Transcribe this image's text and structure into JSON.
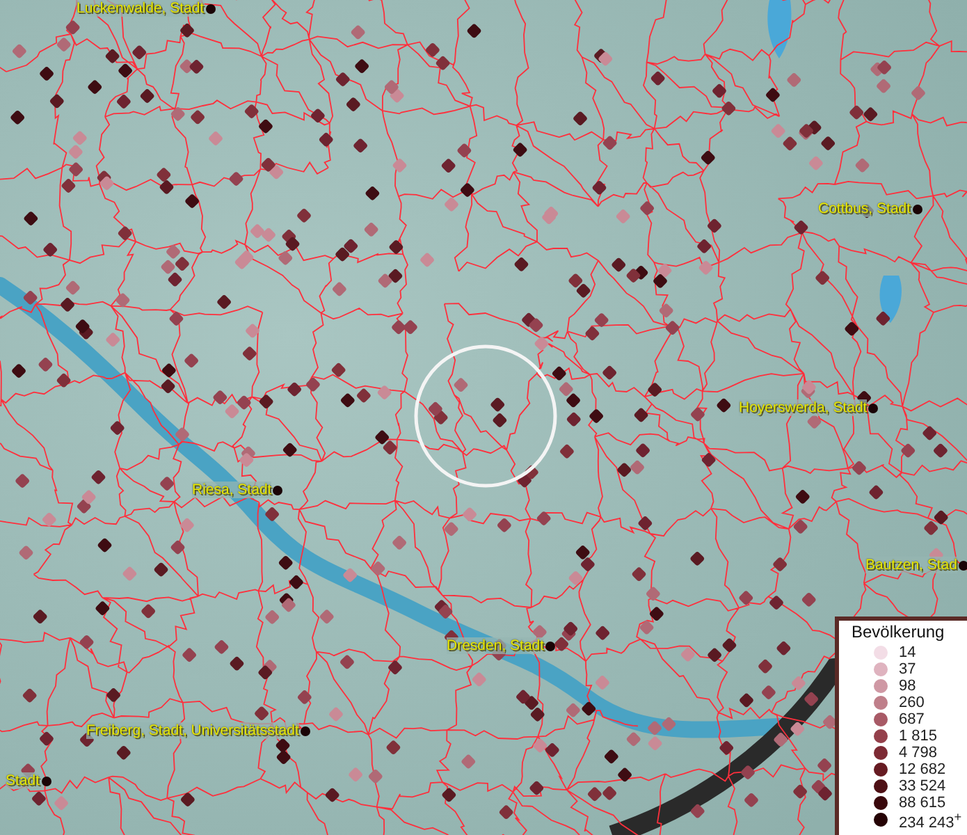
{
  "map": {
    "place_labels": [
      {
        "label": "Luckenwalde, Stadt"
      },
      {
        "label": "Cottbus, Stadt"
      },
      {
        "label": "Hoyerswerda, Stadt"
      },
      {
        "label": "Riesa, Stadt"
      },
      {
        "label": "Bautzen, Stad"
      },
      {
        "label": "Dresden, Stadt"
      },
      {
        "label": "Freiberg, Stadt, Universitätsstadt"
      },
      {
        "label": "Stadt"
      }
    ]
  },
  "legend": {
    "title": "Bevölkerung",
    "items": [
      {
        "label": "14",
        "color": "#f3dde6"
      },
      {
        "label": "37",
        "color": "#dfb3bf"
      },
      {
        "label": "98",
        "color": "#cf98a4"
      },
      {
        "label": "260",
        "color": "#bf7f8a"
      },
      {
        "label": "687",
        "color": "#a85a66"
      },
      {
        "label": "1 815",
        "color": "#94404b"
      },
      {
        "label": "4 798",
        "color": "#7d2a34"
      },
      {
        "label": "12 682",
        "color": "#661b22"
      },
      {
        "label": "33 524",
        "color": "#4e1015"
      },
      {
        "label": "88 615",
        "color": "#3a080c"
      },
      {
        "label": "234 243$^{+}$",
        "color": "#250305"
      }
    ]
  }
}
